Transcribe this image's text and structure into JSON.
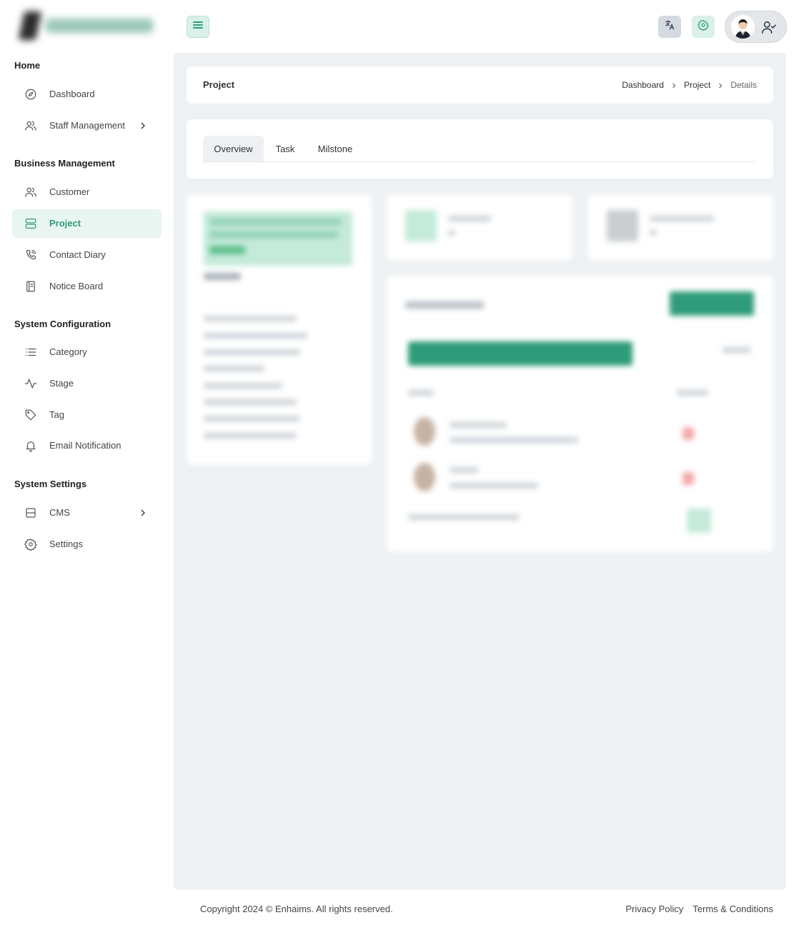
{
  "sidebar": {
    "sections": [
      {
        "title": "Home"
      },
      {
        "title": "Business Management"
      },
      {
        "title": "System Configuration"
      },
      {
        "title": "System Settings"
      }
    ],
    "items": [
      {
        "label": "Dashboard",
        "icon": "compass-icon"
      },
      {
        "label": "Staff Management",
        "icon": "users-icon",
        "has_submenu": true
      },
      {
        "label": "Customer",
        "icon": "users-icon"
      },
      {
        "label": "Project",
        "icon": "server-icon",
        "active": true
      },
      {
        "label": "Contact Diary",
        "icon": "phone-icon"
      },
      {
        "label": "Notice Board",
        "icon": "notebook-icon"
      },
      {
        "label": "Category",
        "icon": "list-icon"
      },
      {
        "label": "Stage",
        "icon": "activity-icon"
      },
      {
        "label": "Tag",
        "icon": "tag-icon"
      },
      {
        "label": "Email Notification",
        "icon": "bell-icon"
      },
      {
        "label": "CMS",
        "icon": "layout-icon",
        "has_submenu": true
      },
      {
        "label": "Settings",
        "icon": "gear-icon"
      }
    ]
  },
  "header": {
    "icons": [
      "menu-icon",
      "translate-icon",
      "gear-icon",
      "user-check-icon"
    ]
  },
  "page": {
    "title": "Project",
    "breadcrumb": [
      "Dashboard",
      "Project",
      "Details"
    ]
  },
  "tabs": [
    "Overview",
    "Task",
    "Milstone"
  ],
  "footer": {
    "copyright": "Copyright 2024 © Enhaims. All rights reserved.",
    "privacy": "Privacy Policy",
    "terms": "Terms & Conditions"
  },
  "colors": {
    "accent": "#2e9c79",
    "accent_light": "#e8f5f0",
    "main_bg": "#eef1f3"
  }
}
